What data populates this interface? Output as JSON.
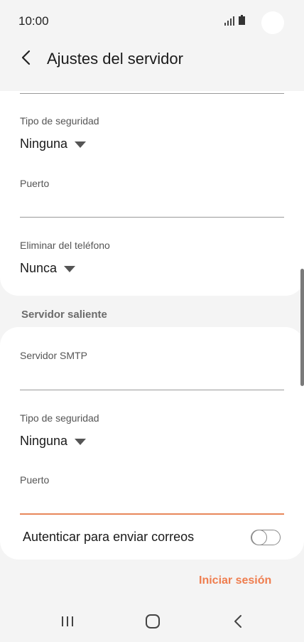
{
  "status": {
    "time": "10:00"
  },
  "header": {
    "title": "Ajustes del servidor"
  },
  "incoming": {
    "security_label": "Tipo de seguridad",
    "security_value": "Ninguna",
    "port_label": "Puerto",
    "port_value": "",
    "delete_label": "Eliminar del teléfono",
    "delete_value": "Nunca"
  },
  "outgoing": {
    "section_title": "Servidor saliente",
    "smtp_label": "Servidor SMTP",
    "smtp_value": "",
    "security_label": "Tipo de seguridad",
    "security_value": "Ninguna",
    "port_label": "Puerto",
    "port_value": "",
    "auth_label": "Autenticar para enviar correos",
    "auth_enabled": false
  },
  "actions": {
    "signin_label": "Iniciar sesión"
  },
  "colors": {
    "accent": "#ef7d4e",
    "field_active": "#e8875a",
    "background": "#f4f4f4"
  }
}
